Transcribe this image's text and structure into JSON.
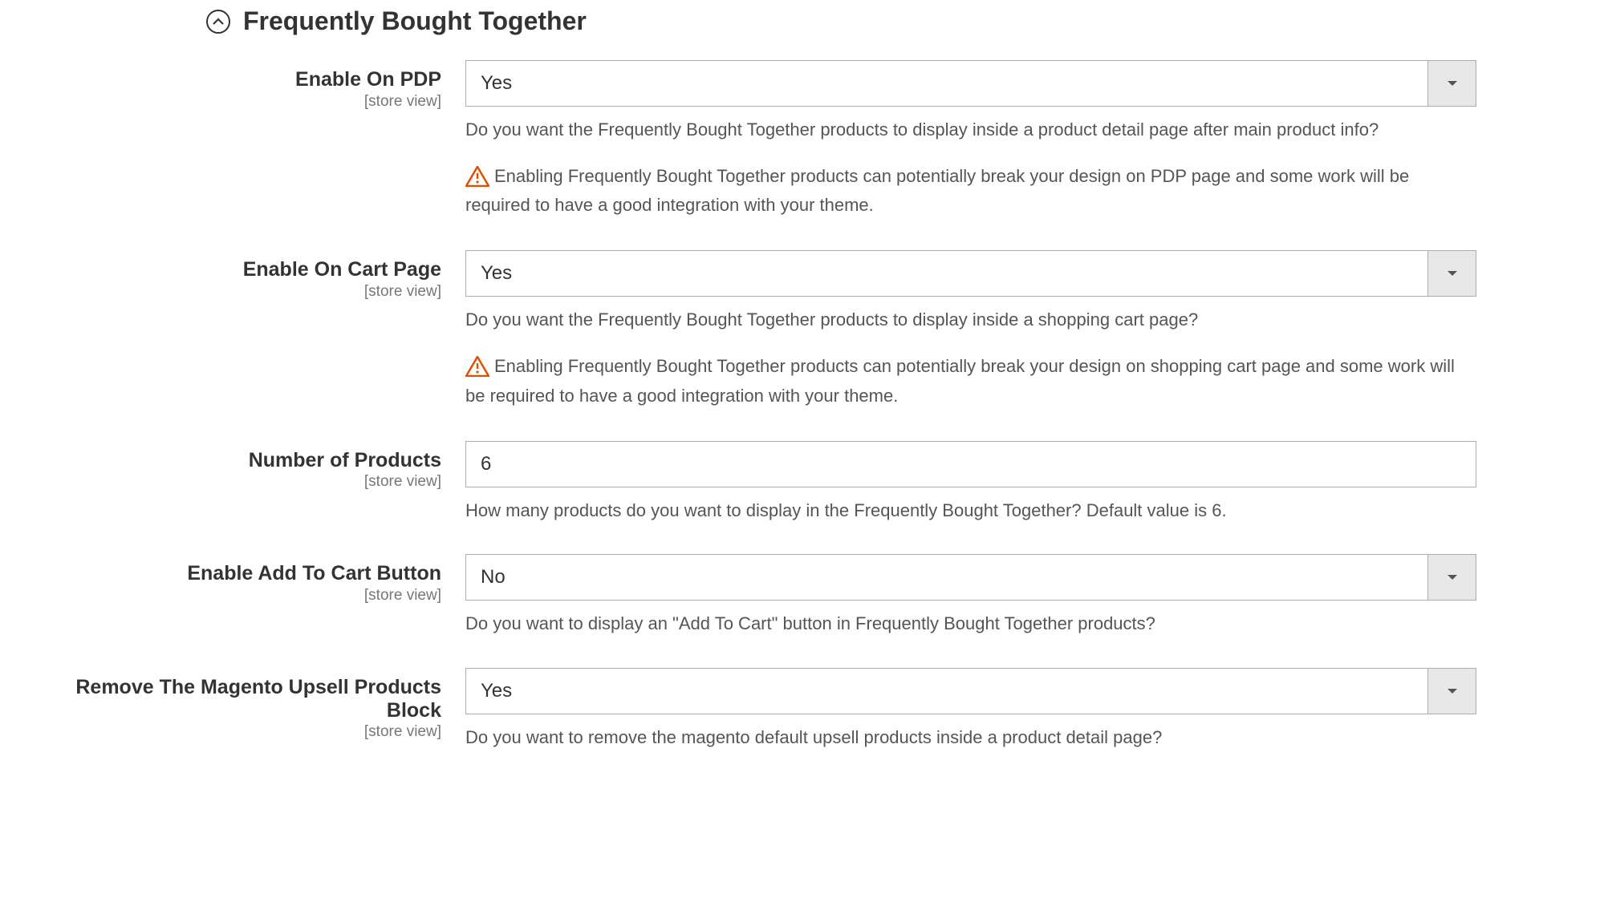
{
  "section": {
    "title": "Frequently Bought Together"
  },
  "scope": "[store view]",
  "fields": {
    "enable_pdp": {
      "label": "Enable On PDP",
      "value": "Yes",
      "help": "Do you want the Frequently Bought Together products to display inside a product detail page after main product info?",
      "warning": "Enabling Frequently Bought Together products can potentially break your design on PDP page and some work will be required to have a good integration with your theme."
    },
    "enable_cart": {
      "label": "Enable On Cart Page",
      "value": "Yes",
      "help": "Do you want the Frequently Bought Together products to display inside a shopping cart page?",
      "warning": "Enabling Frequently Bought Together products can potentially break your design on shopping cart page and some work will be required to have a good integration with your theme."
    },
    "num_products": {
      "label": "Number of Products",
      "value": "6",
      "help": "How many products do you want to display in the Frequently Bought Together? Default value is 6."
    },
    "enable_add_to_cart": {
      "label": "Enable Add To Cart Button",
      "value": "No",
      "help": "Do you want to display an \"Add To Cart\" button in Frequently Bought Together products?"
    },
    "remove_upsell": {
      "label": "Remove The Magento Upsell Products Block",
      "value": "Yes",
      "help": "Do you want to remove the magento default upsell products inside a product detail page?"
    }
  }
}
